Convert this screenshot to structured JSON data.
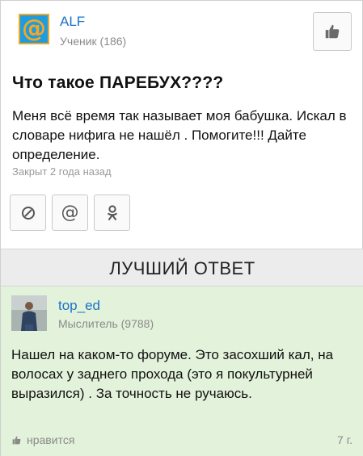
{
  "question": {
    "author": {
      "name": "ALF",
      "rank": "Ученик (186)",
      "avatar_icon": "mail-at-icon"
    },
    "title": "Что такое ПАРЕБУХ????",
    "body": "Меня всё время так называет моя бабушка. Искал в словаре нифига не нашёл . Помогите!!! Дайте определение.",
    "status": "Закрыт 2 года назад",
    "share_buttons": [
      {
        "icon": "block-icon",
        "glyph": "⊘"
      },
      {
        "icon": "at-icon",
        "glyph": "@"
      },
      {
        "icon": "odnoklassniki-icon",
        "glyph": "ꕤ"
      }
    ]
  },
  "best_answer": {
    "header": "ЛУЧШИЙ ОТВЕТ",
    "author": {
      "name": "top_ed",
      "rank": "Мыслитель (9788)"
    },
    "body": "Нашел на каком-то форуме. Это засохший кал, на волосах у заднего прохода (это я покультурней выразился) . За точность не ручаюсь.",
    "like_label": "нравится",
    "age": "7 г."
  },
  "colors": {
    "link": "#1a73c9",
    "answer_bg": "#e3f2da",
    "mail_blue": "#1e9ce0",
    "mail_orange": "#f6a623"
  }
}
